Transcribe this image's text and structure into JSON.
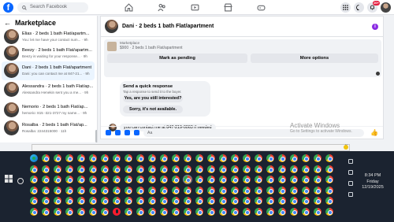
{
  "topbar": {
    "search_placeholder": "Search Facebook",
    "notif_count": "20+"
  },
  "sidebar": {
    "title": "Marketplace",
    "conversations": [
      {
        "title": "Elias · 2 beds 1 bath Flat/apartm...",
        "subtitle": "You: let me have your contact num... · 9h"
      },
      {
        "title": "Beezy · 2 beds 1 bath Flat/apartm...",
        "subtitle": "Beezy is waiting for your response... · 9h"
      },
      {
        "title": "Dani · 2 beds 1 bath Flat/apartment",
        "subtitle": "Dani: you can contact me at 847-21... · 9h"
      },
      {
        "title": "Alessandra · 2 beds 1 bath Flat/ap...",
        "subtitle": "Alessandra Henekin sent you a me... · 9h"
      },
      {
        "title": "Nemorio · 2 beds 1 bath Flat/ap...",
        "subtitle": "hemorio: 815 -321-3727 my name... · 9h"
      },
      {
        "title": "Rosalba · 2 beds 1 bath Flat/ap...",
        "subtitle": "Rosalba: 2244315000 · 11h"
      }
    ]
  },
  "chat": {
    "name": "Dani · 2 beds 1 bath Flat/apartment",
    "listing_category": "Marketplace",
    "listing_title": "$900 · 2 beds 1 bath Flat/apartment",
    "mark_pending_label": "Mark as pending",
    "more_options_label": "More options",
    "quick_title": "Send a quick response",
    "quick_subtitle": "Tap a response to send it to the buyer.",
    "reply_1": "Yes, are you still interested?",
    "reply_2": "Sorry, it's not available.",
    "last_message": "you can contact me at 847-219-0063 if needed",
    "composer_placeholder": "Aa"
  },
  "watermark": {
    "line1": "Activate Windows",
    "line2": "Go to Settings to activate Windows."
  },
  "tray": {
    "time": "8:34 PM",
    "day": "Friday",
    "date": "12/19/2025"
  }
}
